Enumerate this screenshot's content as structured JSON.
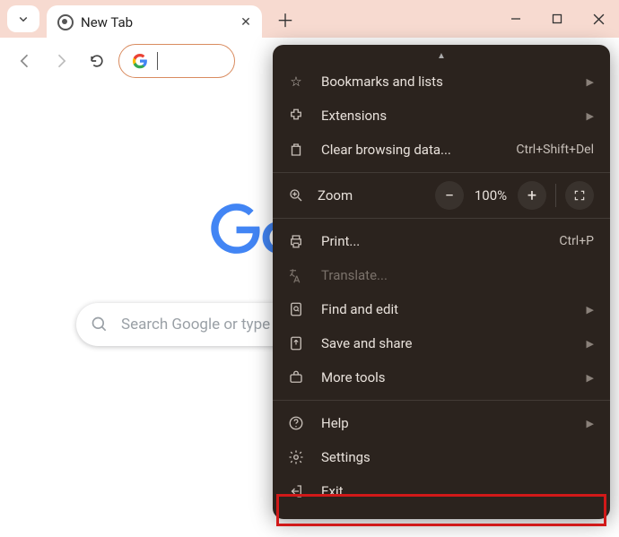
{
  "tabstrip": {
    "tab_title": "New Tab"
  },
  "searchbox": {
    "placeholder": "Search Google or type a URL"
  },
  "menu": {
    "bookmarks": "Bookmarks and lists",
    "extensions": "Extensions",
    "clear_data": "Clear browsing data...",
    "clear_data_kbd": "Ctrl+Shift+Del",
    "zoom_label": "Zoom",
    "zoom_value": "100%",
    "print": "Print...",
    "print_kbd": "Ctrl+P",
    "translate": "Translate...",
    "find": "Find and edit",
    "save_share": "Save and share",
    "more_tools": "More tools",
    "help": "Help",
    "settings": "Settings",
    "exit": "Exit"
  }
}
